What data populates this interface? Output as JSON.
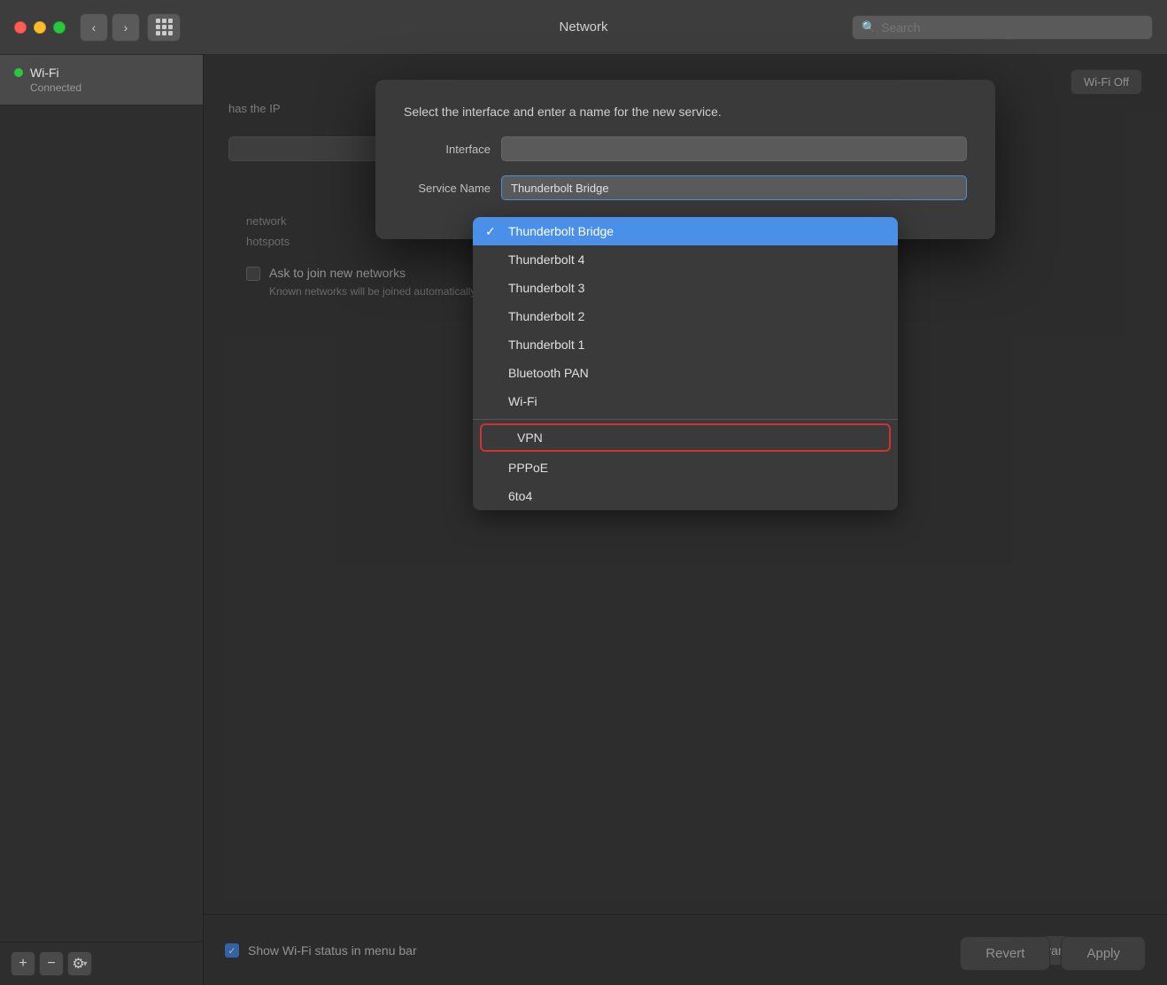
{
  "titlebar": {
    "title": "Network",
    "search_placeholder": "Search"
  },
  "sidebar": {
    "items": [
      {
        "name": "Wi-Fi",
        "status": "Connected",
        "active": true
      }
    ],
    "add_label": "+",
    "remove_label": "−",
    "gear_label": "⚙"
  },
  "dialog": {
    "title": "Select the interface and enter a name for the new service.",
    "interface_label": "Interface",
    "service_name_label": "Service Name",
    "service_name_value": "Thunderbolt Bridge",
    "dropdown_items": [
      {
        "label": "Thunderbolt Bridge",
        "selected": true
      },
      {
        "label": "Thunderbolt 4",
        "selected": false
      },
      {
        "label": "Thunderbolt 3",
        "selected": false
      },
      {
        "label": "Thunderbolt 2",
        "selected": false
      },
      {
        "label": "Thunderbolt 1",
        "selected": false
      },
      {
        "label": "Bluetooth PAN",
        "selected": false
      },
      {
        "label": "Wi-Fi",
        "selected": false
      }
    ],
    "separator": true,
    "special_items": [
      {
        "label": "VPN",
        "circled": true
      },
      {
        "label": "PPPoE",
        "circled": false
      },
      {
        "label": "6to4",
        "circled": false
      }
    ]
  },
  "right_panel": {
    "wifi_off_btn": "Wi-Fi Off",
    "ip_text": "has the IP",
    "ask_join_label": "Ask to join new networks",
    "ask_join_desc": "Known networks will be joined automatically. If no known networks are available, you will have to manually select a network.",
    "show_wifi_label": "Show Wi-Fi status in menu bar",
    "show_wifi_checked": true,
    "advanced_btn": "Advanced...",
    "help_symbol": "?"
  },
  "footer": {
    "revert_label": "Revert",
    "apply_label": "Apply"
  },
  "colors": {
    "selected_bg": "#4a8fe8",
    "vpn_border": "#cc3333"
  }
}
